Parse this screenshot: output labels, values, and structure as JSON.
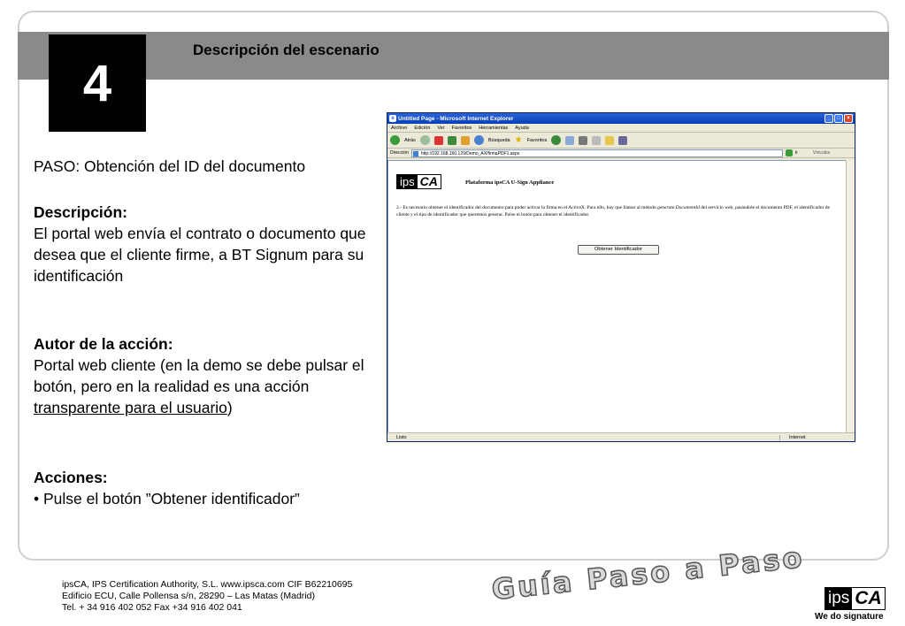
{
  "header": {
    "step_number": "4",
    "title": "Descripción del escenario"
  },
  "content": {
    "paso": "PASO: Obtención del ID del documento",
    "descripcion_heading": "Descripción:",
    "descripcion_text": "El portal web envía el contrato o documento que desea que el cliente firme, a BT Signum para su identificación",
    "autor_heading": "Autor de la acción:",
    "autor_text_pre": "Portal web cliente (en la demo se debe pulsar el botón, pero en la realidad es una acción ",
    "autor_text_link": "transparente para el usuario",
    "autor_text_post": ")",
    "acciones_heading": "Acciones:",
    "acciones_item": "• Pulse el botón ”Obtener identificador”"
  },
  "browser": {
    "title": "Untitled Page - Microsoft Internet Explorer",
    "menu": [
      "Archivo",
      "Edición",
      "Ver",
      "Favoritos",
      "Herramientas",
      "Ayuda"
    ],
    "toolbar": {
      "back": "Atrás",
      "search": "Búsqueda",
      "favorites": "Favoritos"
    },
    "address_label": "Dirección",
    "address_url": "http://192.168.160.129/Demo_AX/firmaPDF1.aspx",
    "go_label": "Ir",
    "links_label": "Vínculos",
    "status_left": "Listo",
    "status_zone": "Internet",
    "page": {
      "logo_ips": "ips",
      "logo_ca": "CA",
      "platform_title": "Plataforma ipsCA U-Sign Appliance",
      "instruction_pre": "2.- Es necesario obtener el identificador del documento para poder activar la firma en el ActiveX. Para ello, hay que llamar al método ",
      "instruction_method": "generate.DocumentId",
      "instruction_post": " del servicio web, pasándole el documento PDF, el identificador de cliente y el tipo de identificador que queremos generar. Pulse el botón para obtener el identificador.",
      "button_label": "Obtener Identificador"
    }
  },
  "footer": {
    "line1": "ipsCA, IPS Certification Authority, S.L.  www.ipsca.com   CIF B62210695",
    "line2": "Edificio ECU, Calle Pollensa s/n, 28290 – Las Matas (Madrid)",
    "line3": "Tel. + 34 916 402 052 Fax  +34 916 402 041",
    "guia": "Guía Paso a Paso",
    "logo_ips": "ips",
    "logo_ca": "CA",
    "tagline": "We do signature"
  }
}
